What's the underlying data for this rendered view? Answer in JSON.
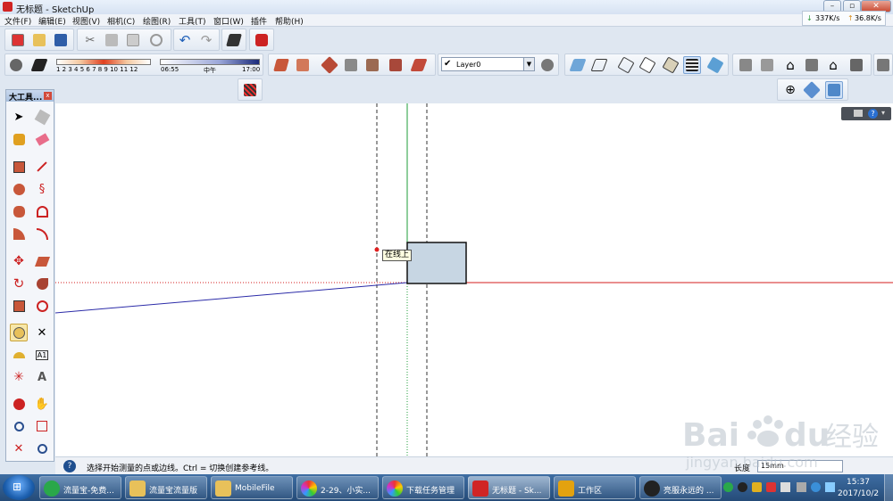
{
  "window": {
    "title": "无标题 - SketchUp",
    "controls": [
      "minimize-icon",
      "maximize-icon",
      "close-icon"
    ]
  },
  "menu": {
    "items": [
      "文件(F)",
      "编辑(E)",
      "视图(V)",
      "相机(C)",
      "绘图(R)",
      "工具(T)",
      "窗口(W)",
      "插件",
      "帮助(H)"
    ]
  },
  "netspeed": {
    "down": "337K/s",
    "up": "36.8K/s"
  },
  "shadow": {
    "month_ticks": "1 2 3 4 5 6 7 8 9 10 11 12",
    "time_start": "06:55",
    "time_mid": "中午",
    "time_end": "17:00"
  },
  "layers": {
    "current": "Layer0"
  },
  "tool_panel": {
    "title": "大工具...",
    "close": "x"
  },
  "canvas": {
    "tooltip": "在线上",
    "axis_colors": {
      "red": "#d41c1c",
      "green": "#1f9d3a",
      "blue": "#2b2ba8"
    },
    "face_color": "#c7d6e3"
  },
  "status": {
    "help_icon": "?",
    "text": "选择开始测量的点或边线。Ctrl = 切换创建参考线。",
    "vcb_label": "长度",
    "vcb_value": "15mm"
  },
  "taskbar": {
    "items": [
      {
        "label": "流量宝-免费...",
        "icon": "flowbao-icon",
        "color": "#2aa84a"
      },
      {
        "label": "流量宝流量版",
        "icon": "folder-icon",
        "color": "#e8c15a"
      },
      {
        "label": "MobileFile",
        "icon": "folder-icon",
        "color": "#e8c15a"
      },
      {
        "label": "2-29、小实...",
        "icon": "pinwheel-icon",
        "color": "#d43a8c"
      },
      {
        "label": "下载任务管理",
        "icon": "pinwheel-icon",
        "color": "#d43a8c"
      },
      {
        "label": "无标题 - Sk...",
        "icon": "sketchup-icon",
        "color": "#d02525"
      },
      {
        "label": "工作区",
        "icon": "toolbox-icon",
        "color": "#e3a20f"
      },
      {
        "label": "亮服永远的 ...",
        "icon": "qq-icon",
        "color": "#222222"
      }
    ],
    "clock_time": "15:37",
    "clock_date": "2017/10/2"
  },
  "watermark": {
    "brand": "Bai",
    "brand_tail": "du",
    "cn": "经验",
    "url": "jingyan.baidu.com"
  }
}
